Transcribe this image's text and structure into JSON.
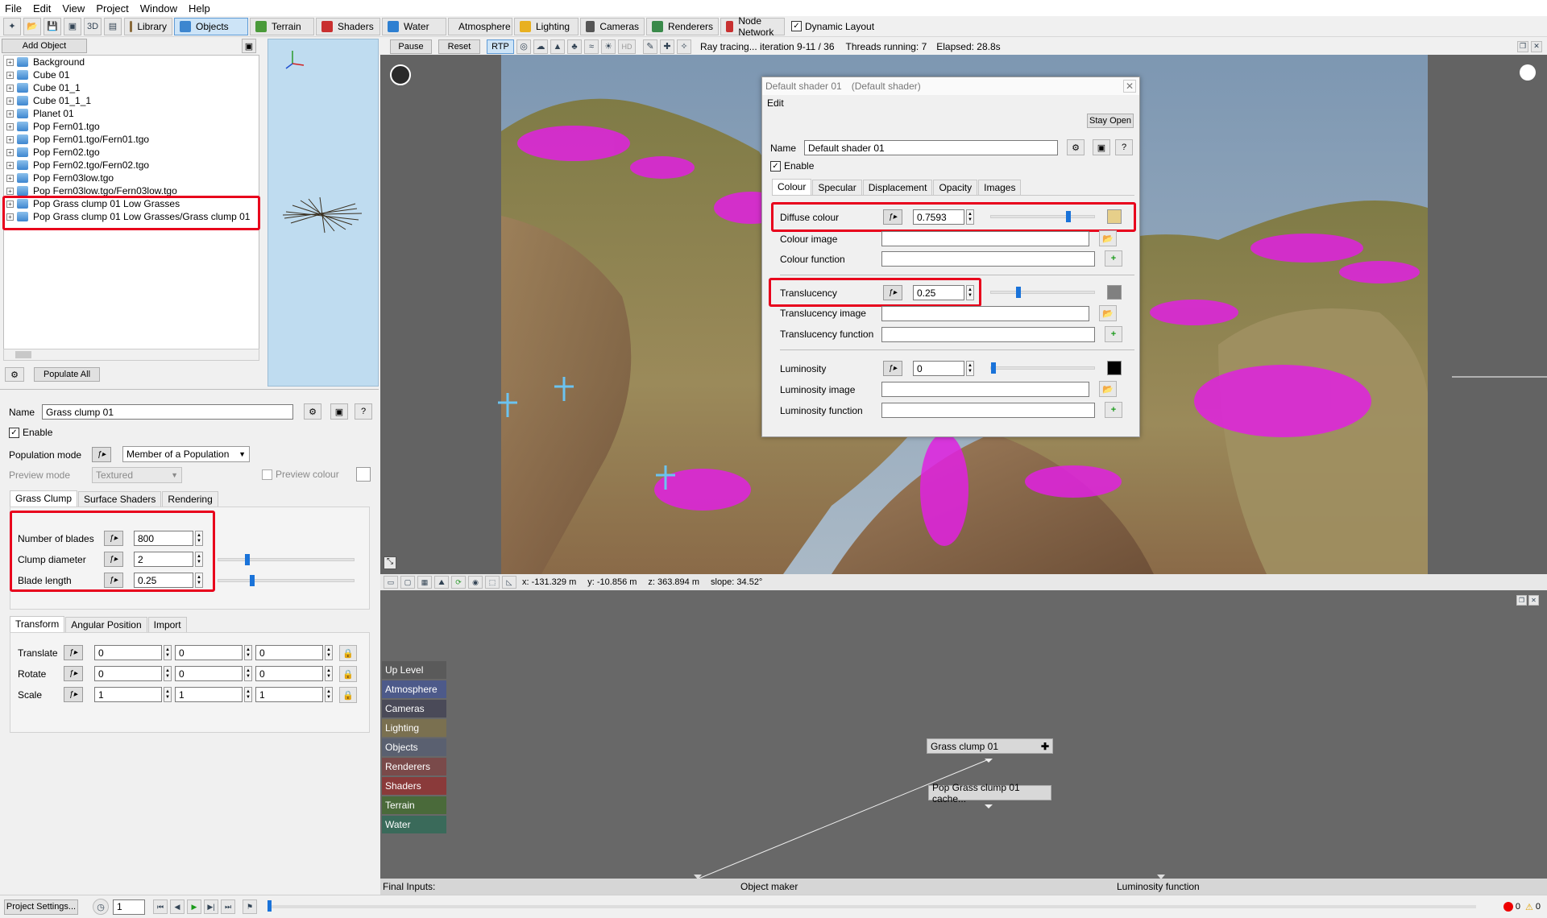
{
  "menu": [
    "File",
    "Edit",
    "View",
    "Project",
    "Window",
    "Help"
  ],
  "toolbar": {
    "tabs": [
      {
        "label": "Library",
        "color": "#8a6a3a"
      },
      {
        "label": "Objects",
        "color": "#3d86cf",
        "active": true
      },
      {
        "label": "Terrain",
        "color": "#4a9a3a"
      },
      {
        "label": "Shaders",
        "color": "#c93030"
      },
      {
        "label": "Water",
        "color": "#2d7fd1"
      },
      {
        "label": "Atmosphere",
        "color": "#5a8fd0"
      },
      {
        "label": "Lighting",
        "color": "#e8b020"
      },
      {
        "label": "Cameras",
        "color": "#555555"
      },
      {
        "label": "Renderers",
        "color": "#3a8a4a"
      },
      {
        "label": "Node Network",
        "color": "#c83030"
      }
    ],
    "dynamic_layout": "Dynamic Layout"
  },
  "left": {
    "add_object": "Add Object",
    "tree": [
      "Background",
      "Cube 01",
      "Cube 01_1",
      "Cube 01_1_1",
      "Planet 01",
      "Pop Fern01.tgo",
      "Pop Fern01.tgo/Fern01.tgo",
      "Pop Fern02.tgo",
      "Pop Fern02.tgo/Fern02.tgo",
      "Pop Fern03low.tgo",
      "Pop Fern03low.tgo/Fern03low.tgo",
      "Pop Grass clump 01 Low Grasses",
      "Pop Grass clump 01 Low Grasses/Grass clump 01"
    ],
    "populate_all": "Populate All",
    "name_label": "Name",
    "name_value": "Grass clump 01",
    "enable": "Enable",
    "population_mode_label": "Population mode",
    "population_mode_value": "Member of a Population",
    "preview_mode_label": "Preview mode",
    "preview_mode_value": "Textured",
    "preview_colour": "Preview colour",
    "tabs1": [
      "Grass Clump",
      "Surface Shaders",
      "Rendering"
    ],
    "params": [
      {
        "label": "Number of blades",
        "value": "800"
      },
      {
        "label": "Clump diameter",
        "value": "2",
        "slider": 0.2
      },
      {
        "label": "Blade length",
        "value": "0.25",
        "slider": 0.24
      }
    ],
    "tabs2": [
      "Transform",
      "Angular Position",
      "Import"
    ],
    "transform": [
      {
        "label": "Translate",
        "values": [
          "0",
          "0",
          "0"
        ]
      },
      {
        "label": "Rotate",
        "values": [
          "0",
          "0",
          "0"
        ]
      },
      {
        "label": "Scale",
        "values": [
          "1",
          "1",
          "1"
        ]
      }
    ]
  },
  "viewport": {
    "buttons": [
      "Pause",
      "Reset",
      "RTP"
    ],
    "status": "Ray tracing... iteration 9-11 / 36",
    "threads": "Threads running: 7",
    "elapsed": "Elapsed: 28.8s",
    "coords": {
      "x": "x: -131.329 m",
      "y": "y: -10.856 m",
      "z": "z: 363.894 m",
      "slope": "slope: 34.52°"
    }
  },
  "dialog": {
    "title": "Default shader 01",
    "subtitle": "(Default shader)",
    "menu": "Edit",
    "stay_open": "Stay Open",
    "name_label": "Name",
    "name_value": "Default shader 01",
    "enable": "Enable",
    "tabs": [
      "Colour",
      "Specular",
      "Displacement",
      "Opacity",
      "Images"
    ],
    "diffuse_label": "Diffuse colour",
    "diffuse_value": "0.7593",
    "diffuse_slider": 0.75,
    "diffuse_swatch": "#e6cf8a",
    "colour_image": "Colour image",
    "colour_function": "Colour function",
    "translucency_label": "Translucency",
    "translucency_value": "0.25",
    "translucency_slider": 0.25,
    "translucency_swatch": "#808080",
    "translucency_image": "Translucency image",
    "translucency_function": "Translucency function",
    "luminosity_label": "Luminosity",
    "luminosity_value": "0",
    "luminosity_slider": 0.0,
    "luminosity_swatch": "#000000",
    "luminosity_image": "Luminosity image",
    "luminosity_function": "Luminosity function"
  },
  "nodes": {
    "categories": [
      {
        "label": "Up Level",
        "color": "#5a5a5a"
      },
      {
        "label": "Atmosphere",
        "color": "#4d5a8a"
      },
      {
        "label": "Cameras",
        "color": "#4a4a58"
      },
      {
        "label": "Lighting",
        "color": "#7a7050"
      },
      {
        "label": "Objects",
        "color": "#5a6070"
      },
      {
        "label": "Renderers",
        "color": "#7a4a4a"
      },
      {
        "label": "Shaders",
        "color": "#8a3a3a"
      },
      {
        "label": "Terrain",
        "color": "#4a6a3a"
      },
      {
        "label": "Water",
        "color": "#3a6a5a"
      }
    ],
    "node1": "Grass clump 01",
    "node2": "Pop Grass clump 01 cache...",
    "final_inputs": "Final Inputs:",
    "input1": "Object maker",
    "input2": "Luminosity function"
  },
  "bottom": {
    "project_settings": "Project Settings...",
    "frame": "1",
    "errors": "0",
    "warnings": "0"
  }
}
